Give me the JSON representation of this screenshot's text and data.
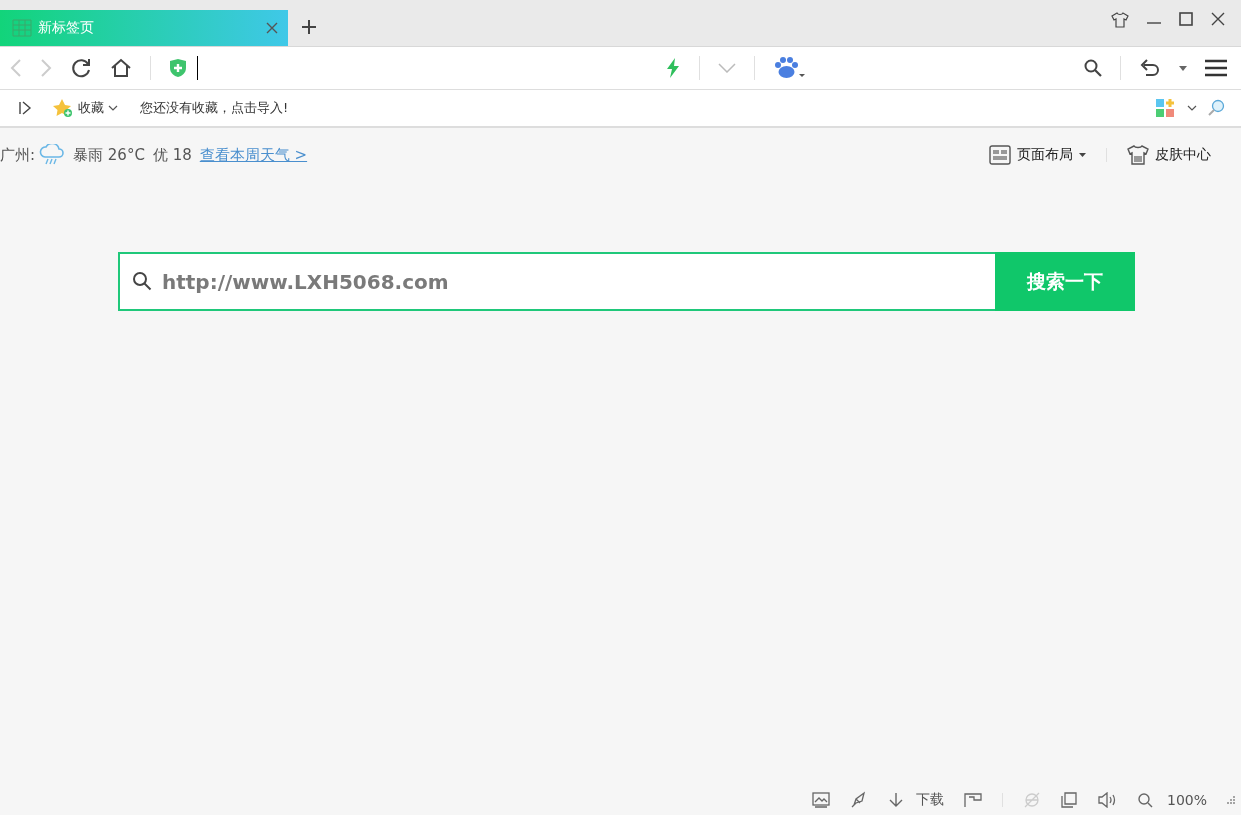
{
  "tabs": [
    {
      "title": "新标签页",
      "selected": true
    }
  ],
  "bookmarks_bar": {
    "folder": "收藏",
    "message": "您还没有收藏，点击导入!"
  },
  "weather": {
    "city": "广州:",
    "condition": "暴雨 26°C",
    "air_quality": "优 18",
    "link": "查看本周天气 >"
  },
  "page_tools": [
    {
      "label": "页面布局",
      "kind": "layout"
    },
    {
      "label": "皮肤中心",
      "kind": "skin"
    }
  ],
  "search": {
    "placeholder": "http://www.LXH5068.com",
    "button": "搜索一下"
  },
  "status_bar": {
    "download": "下载",
    "zoom": "100%"
  }
}
